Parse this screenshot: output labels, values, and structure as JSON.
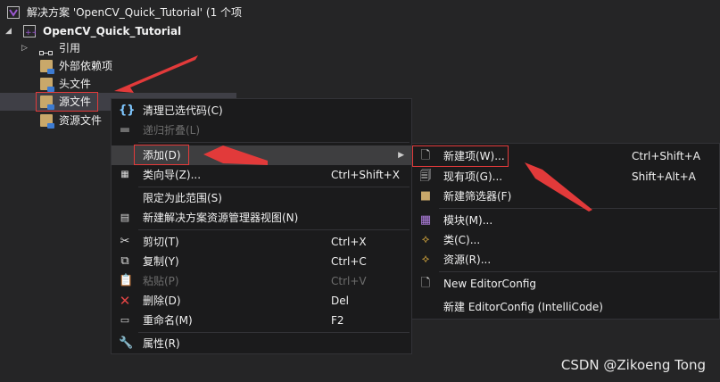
{
  "explorer": {
    "solution_title": "解决方案 'OpenCV_Quick_Tutorial' (1 个项",
    "project": "OpenCV_Quick_Tutorial",
    "items": [
      "引用",
      "外部依赖项",
      "头文件",
      "源文件",
      "资源文件"
    ]
  },
  "context_menu": {
    "items": [
      {
        "label": "清理已选代码(C)"
      },
      {
        "label": "递归折叠(L)"
      },
      {
        "label": "添加(D)"
      },
      {
        "label": "类向导(Z)...",
        "shortcut": "Ctrl+Shift+X"
      },
      {
        "label": "限定为此范围(S)"
      },
      {
        "label": "新建解决方案资源管理器视图(N)"
      },
      {
        "label": "剪切(T)",
        "shortcut": "Ctrl+X"
      },
      {
        "label": "复制(Y)",
        "shortcut": "Ctrl+C"
      },
      {
        "label": "粘贴(P)",
        "shortcut": "Ctrl+V"
      },
      {
        "label": "删除(D)",
        "shortcut": "Del"
      },
      {
        "label": "重命名(M)",
        "shortcut": "F2"
      },
      {
        "label": "属性(R)"
      }
    ]
  },
  "submenu": {
    "items": [
      {
        "label": "新建项(W)...",
        "shortcut": "Ctrl+Shift+A"
      },
      {
        "label": "现有项(G)...",
        "shortcut": "Shift+Alt+A"
      },
      {
        "label": "新建筛选器(F)"
      },
      {
        "label": "模块(M)..."
      },
      {
        "label": "类(C)..."
      },
      {
        "label": "资源(R)..."
      },
      {
        "label": "New EditorConfig"
      },
      {
        "label": "新建 EditorConfig (IntelliCode)"
      }
    ]
  },
  "watermark": "CSDN @Zikoeng Tong",
  "colors": {
    "background": "#252526",
    "menu": "#1b1b1c",
    "highlight": "#e23a3a",
    "vs_purple": "#9b59d0"
  }
}
